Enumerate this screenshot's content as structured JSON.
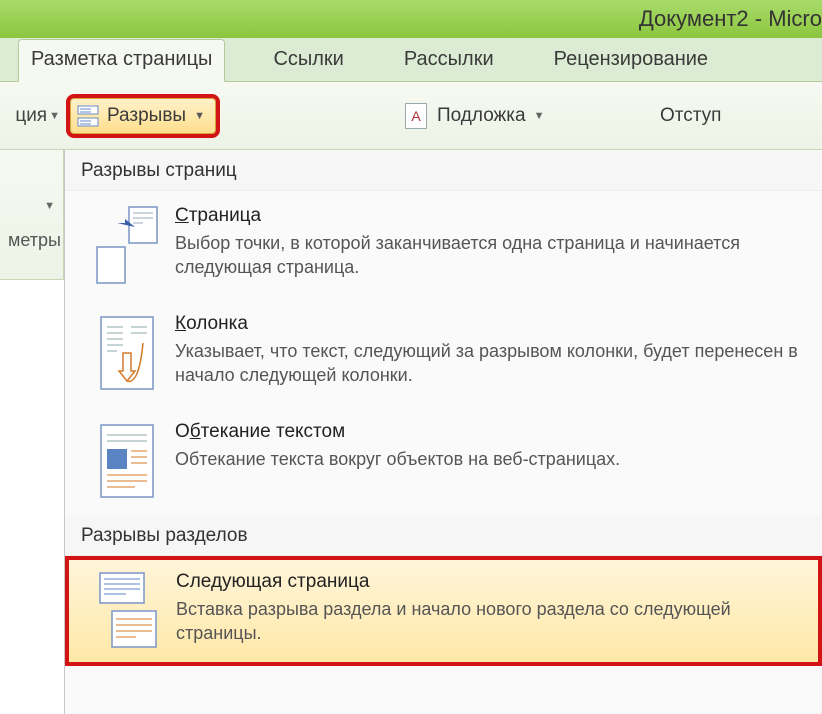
{
  "title_bar": "Документ2 - Micro",
  "tabs": {
    "page_layout": "Разметка страницы",
    "references": "Ссылки",
    "mailings": "Рассылки",
    "review": "Рецензирование"
  },
  "ribbon": {
    "orientation_fragment": "ция",
    "breaks_label": "Разрывы",
    "watermark_label": "Подложка",
    "indent_label": "Отступ",
    "params_fragment": "метры"
  },
  "dropdown": {
    "section_page_breaks": "Разрывы страниц",
    "section_section_breaks": "Разрывы разделов",
    "items": {
      "page": {
        "title_pre": "",
        "title_u": "С",
        "title_post": "траница",
        "desc": "Выбор точки, в которой заканчивается одна страница и начинается следующая страница."
      },
      "column": {
        "title_pre": "",
        "title_u": "К",
        "title_post": "олонка",
        "desc": "Указывает, что текст, следующий за разрывом колонки, будет перенесен в начало следующей колонки."
      },
      "text_wrap": {
        "title_pre": "О",
        "title_u": "б",
        "title_post": "текание текстом",
        "desc": "Обтекание текста вокруг объектов на веб-страницах."
      },
      "next_page": {
        "title": "Следующая страница",
        "desc": "Вставка разрыва раздела и начало нового раздела со следующей страницы."
      }
    }
  }
}
